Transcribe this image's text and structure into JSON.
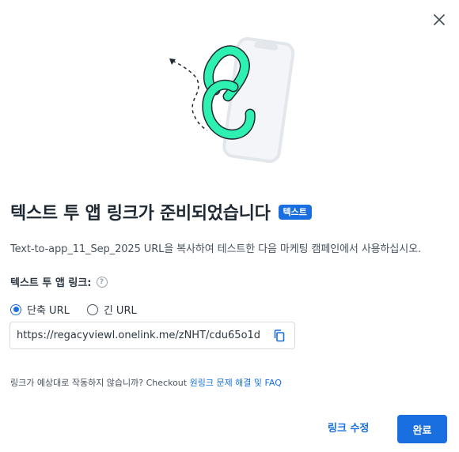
{
  "dialog": {
    "title": "텍스트 투 앱 링크가 준비되었습니다",
    "badge": "텍스트",
    "description": "Text-to-app_11_Sep_2025 URL을 복사하여 테스트한 다음 마케팅 캠페인에서 사용하십시오.",
    "field_label": "텍스트 투 앱 링크:",
    "help_symbol": "?",
    "radio_options": [
      {
        "label": "단축 URL",
        "checked": true
      },
      {
        "label": "긴 URL",
        "checked": false
      }
    ],
    "url_value": "https://regacyviewl.onelink.me/zNHT/cdu65o1d",
    "footer_text": "링크가 예상대로 작동하지 않습니까? Checkout ",
    "footer_link": "원링크 문제 해결 및 FAQ",
    "edit_button": "링크 수정",
    "done_button": "완료"
  },
  "icons": {
    "close": "close-icon",
    "copy": "copy-icon",
    "help": "help-circle-icon",
    "illustration": "chain-link-phone-illustration"
  },
  "colors": {
    "accent": "#1a6fe0",
    "chain": "#2ef0b0",
    "chain_outline": "#1f2933",
    "phone": "#e7eaef"
  }
}
